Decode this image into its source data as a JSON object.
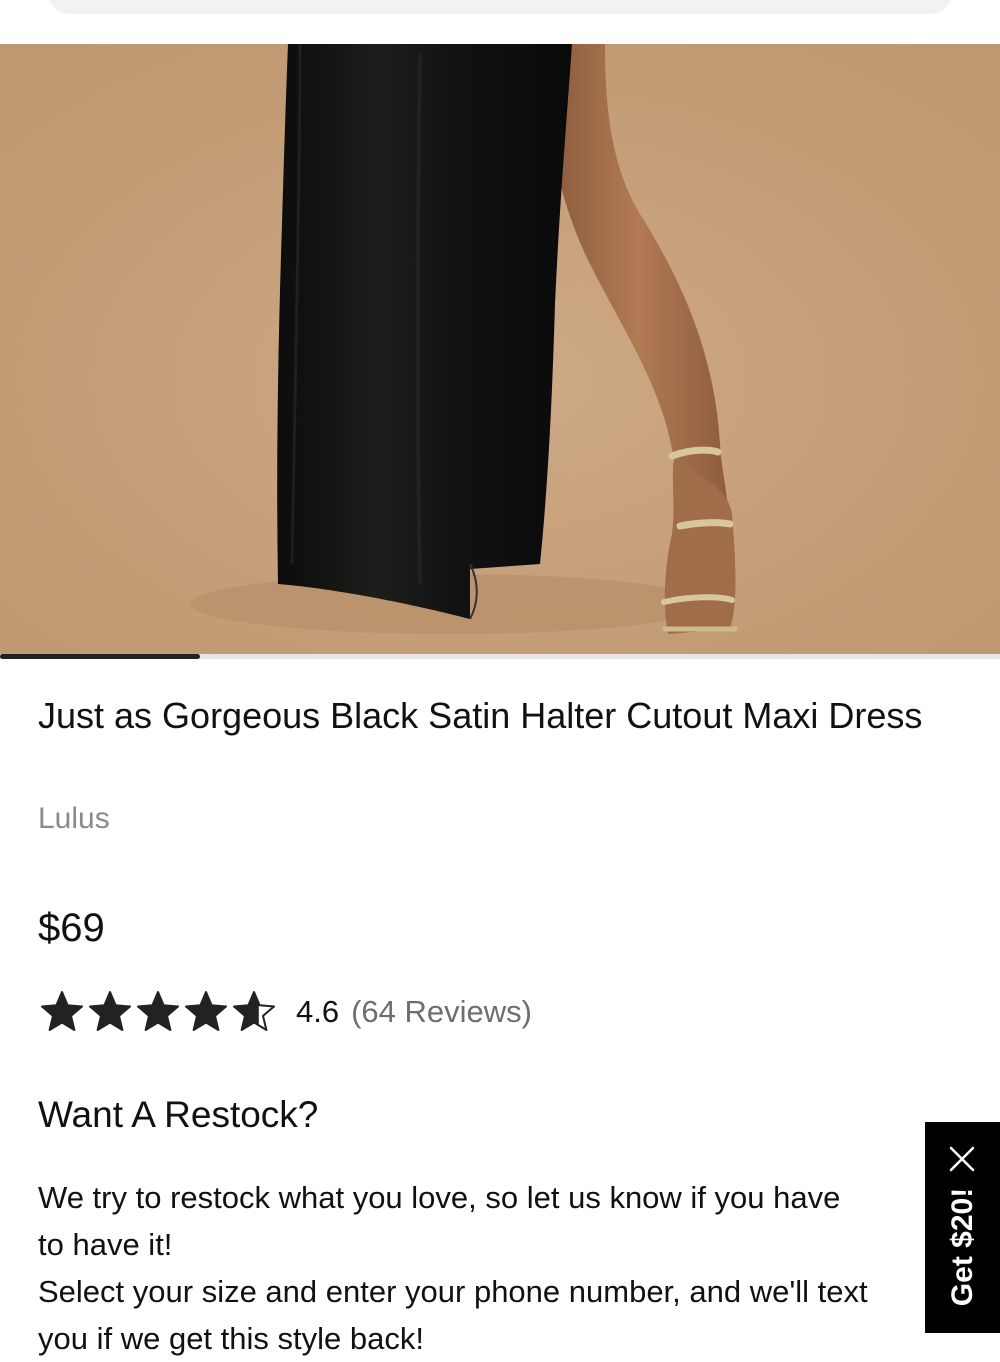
{
  "product": {
    "title": "Just as Gorgeous Black Satin Halter Cutout Maxi Dress",
    "brand": "Lulus",
    "price": "$69",
    "rating": {
      "value": "4.6",
      "stars_out_of_5": 4.6,
      "reviews_label": "(64 Reviews)"
    }
  },
  "gallery": {
    "image_alt": "Model wearing black satin maxi dress with leg slit and gold strappy sandals",
    "progress_fraction": 0.2
  },
  "restock": {
    "heading": "Want A Restock?",
    "lines": [
      "We try to restock what you love, so let us know if you have",
      "to have it!",
      "Select your size and enter your phone number, and we'll text",
      "you if we get this style back!"
    ]
  },
  "promo": {
    "label": "Get $20!"
  },
  "colors": {
    "backdrop": "#c8a17c",
    "dress": "#111111",
    "promo_bg": "#000000",
    "muted_text": "#8a8a8a"
  }
}
